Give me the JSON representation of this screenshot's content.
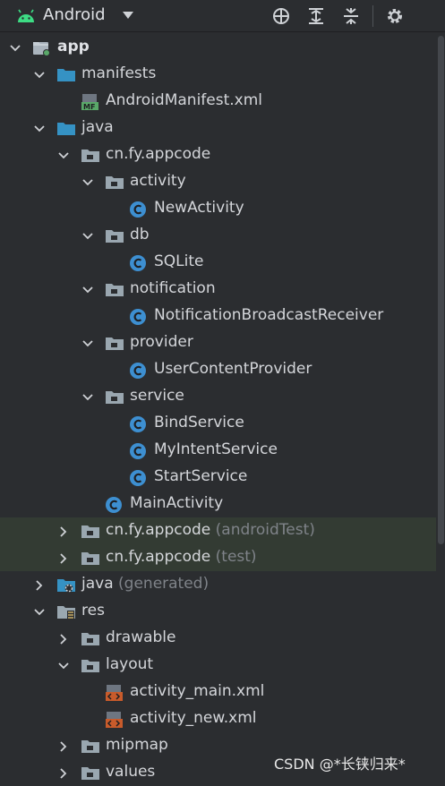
{
  "toolbar": {
    "view_label": "Android",
    "icons": [
      "android-icon",
      "dropdown-caret-icon",
      "locate-icon",
      "expand-all-icon",
      "collapse-all-icon",
      "gear-icon"
    ]
  },
  "tree": [
    {
      "label": "app",
      "extra": "",
      "depth": 0,
      "icon": "module",
      "expanded": true,
      "bold": true,
      "highlight": false
    },
    {
      "label": "manifests",
      "extra": "",
      "depth": 1,
      "icon": "folder-blue",
      "expanded": true,
      "bold": false,
      "highlight": false
    },
    {
      "label": "AndroidManifest.xml",
      "extra": "",
      "depth": 2,
      "icon": "manifest",
      "expanded": null,
      "bold": false,
      "highlight": false
    },
    {
      "label": "java",
      "extra": "",
      "depth": 1,
      "icon": "folder-blue",
      "expanded": true,
      "bold": false,
      "highlight": false
    },
    {
      "label": "cn.fy.appcode",
      "extra": "",
      "depth": 2,
      "icon": "package",
      "expanded": true,
      "bold": false,
      "highlight": false
    },
    {
      "label": "activity",
      "extra": "",
      "depth": 3,
      "icon": "package",
      "expanded": true,
      "bold": false,
      "highlight": false
    },
    {
      "label": "NewActivity",
      "extra": "",
      "depth": 4,
      "icon": "class",
      "expanded": null,
      "bold": false,
      "highlight": false
    },
    {
      "label": "db",
      "extra": "",
      "depth": 3,
      "icon": "package",
      "expanded": true,
      "bold": false,
      "highlight": false
    },
    {
      "label": "SQLite",
      "extra": "",
      "depth": 4,
      "icon": "class",
      "expanded": null,
      "bold": false,
      "highlight": false
    },
    {
      "label": "notification",
      "extra": "",
      "depth": 3,
      "icon": "package",
      "expanded": true,
      "bold": false,
      "highlight": false
    },
    {
      "label": "NotificationBroadcastReceiver",
      "extra": "",
      "depth": 4,
      "icon": "class",
      "expanded": null,
      "bold": false,
      "highlight": false
    },
    {
      "label": "provider",
      "extra": "",
      "depth": 3,
      "icon": "package",
      "expanded": true,
      "bold": false,
      "highlight": false
    },
    {
      "label": "UserContentProvider",
      "extra": "",
      "depth": 4,
      "icon": "class",
      "expanded": null,
      "bold": false,
      "highlight": false
    },
    {
      "label": "service",
      "extra": "",
      "depth": 3,
      "icon": "package",
      "expanded": true,
      "bold": false,
      "highlight": false
    },
    {
      "label": "BindService",
      "extra": "",
      "depth": 4,
      "icon": "class",
      "expanded": null,
      "bold": false,
      "highlight": false
    },
    {
      "label": "MyIntentService",
      "extra": "",
      "depth": 4,
      "icon": "class",
      "expanded": null,
      "bold": false,
      "highlight": false
    },
    {
      "label": "StartService",
      "extra": "",
      "depth": 4,
      "icon": "class",
      "expanded": null,
      "bold": false,
      "highlight": false
    },
    {
      "label": "MainActivity",
      "extra": "",
      "depth": 3,
      "icon": "class",
      "expanded": null,
      "bold": false,
      "highlight": false
    },
    {
      "label": "cn.fy.appcode",
      "extra": "(androidTest)",
      "depth": 2,
      "icon": "package",
      "expanded": false,
      "bold": false,
      "highlight": true
    },
    {
      "label": "cn.fy.appcode",
      "extra": "(test)",
      "depth": 2,
      "icon": "package",
      "expanded": false,
      "bold": false,
      "highlight": true
    },
    {
      "label": "java",
      "extra": "(generated)",
      "depth": 1,
      "icon": "folder-generated",
      "expanded": false,
      "bold": false,
      "highlight": false
    },
    {
      "label": "res",
      "extra": "",
      "depth": 1,
      "icon": "folder-res",
      "expanded": true,
      "bold": false,
      "highlight": false
    },
    {
      "label": "drawable",
      "extra": "",
      "depth": 2,
      "icon": "package",
      "expanded": false,
      "bold": false,
      "highlight": false
    },
    {
      "label": "layout",
      "extra": "",
      "depth": 2,
      "icon": "package",
      "expanded": true,
      "bold": false,
      "highlight": false
    },
    {
      "label": "activity_main.xml",
      "extra": "",
      "depth": 3,
      "icon": "layout-xml",
      "expanded": null,
      "bold": false,
      "highlight": false
    },
    {
      "label": "activity_new.xml",
      "extra": "",
      "depth": 3,
      "icon": "layout-xml",
      "expanded": null,
      "bold": false,
      "highlight": false
    },
    {
      "label": "mipmap",
      "extra": "",
      "depth": 2,
      "icon": "package",
      "expanded": false,
      "bold": false,
      "highlight": false
    },
    {
      "label": "values",
      "extra": "",
      "depth": 2,
      "icon": "package",
      "expanded": false,
      "bold": false,
      "highlight": false
    }
  ],
  "watermark": "CSDN @*长铗归来*",
  "colors": {
    "background": "#2b2d30",
    "highlight_row": "#333b33",
    "folder_blue": "#3592c4",
    "package_gray": "#9aa7b0",
    "class_circle": "#3d8fd1",
    "manifest_green": "#59a869",
    "xml_orange": "#c85b2b"
  }
}
